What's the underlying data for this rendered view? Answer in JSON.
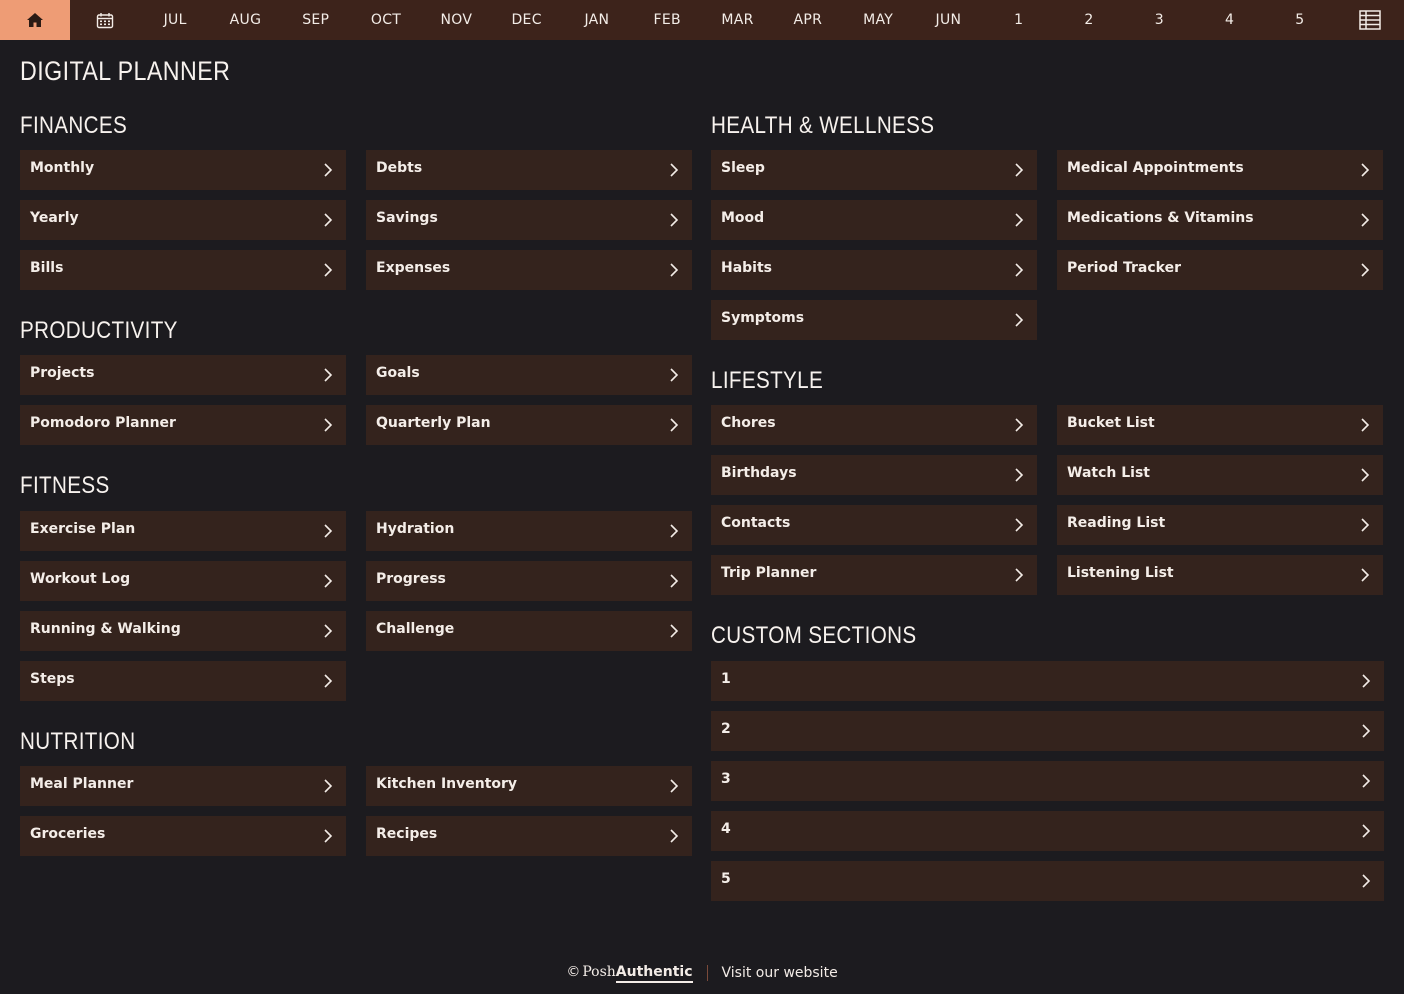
{
  "colors": {
    "nav_bg": "#3d231b",
    "accent": "#ee9c75",
    "card_bg": "#34231d",
    "page_bg": "#1c1b1f"
  },
  "nav": {
    "home_icon": "home-icon",
    "calendar_icon": "calendar-icon",
    "grid_icon": "table-grid-icon",
    "items": [
      "JUL",
      "AUG",
      "SEP",
      "OCT",
      "NOV",
      "DEC",
      "JAN",
      "FEB",
      "MAR",
      "APR",
      "MAY",
      "JUN",
      "1",
      "2",
      "3",
      "4",
      "5"
    ]
  },
  "page_title": "DIGITAL PLANNER",
  "finances": {
    "title": "FINANCES",
    "items": [
      "Monthly",
      "Debts",
      "Yearly",
      "Savings",
      "Bills",
      "Expenses"
    ]
  },
  "productivity": {
    "title": "PRODUCTIVITY",
    "items": [
      "Projects",
      "Goals",
      "Pomodoro Planner",
      "Quarterly Plan"
    ]
  },
  "fitness": {
    "title": "FITNESS",
    "items": [
      "Exercise Plan",
      "Hydration",
      "Workout Log",
      "Progress",
      "Running & Walking",
      "Challenge",
      "Steps"
    ]
  },
  "nutrition": {
    "title": "NUTRITION",
    "items": [
      "Meal Planner",
      "Kitchen Inventory",
      "Groceries",
      "Recipes"
    ]
  },
  "health": {
    "title": "HEALTH & WELLNESS",
    "items": [
      "Sleep",
      "Medical Appointments",
      "Mood",
      "Medications & Vitamins",
      "Habits",
      "Period Tracker",
      "Symptoms"
    ]
  },
  "lifestyle": {
    "title": "LIFESTYLE",
    "items": [
      "Chores",
      "Bucket List",
      "Birthdays",
      "Watch List",
      "Contacts",
      "Reading List",
      "Trip Planner",
      "Listening List"
    ]
  },
  "custom": {
    "title": "CUSTOM SECTIONS",
    "items": [
      "1",
      "2",
      "3",
      "4",
      "5"
    ]
  },
  "footer": {
    "copyright": "©",
    "brand_a": "Posh",
    "brand_b": "Authentic",
    "link": "Visit our website"
  }
}
